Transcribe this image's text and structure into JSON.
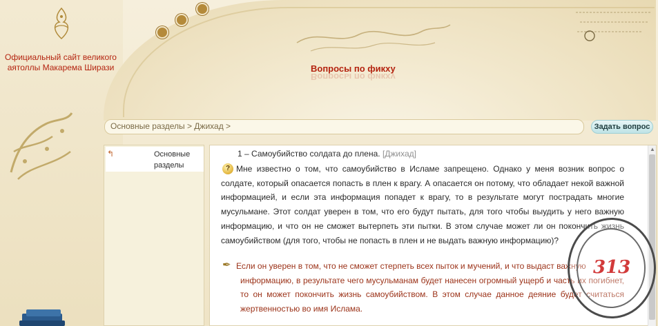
{
  "site": {
    "title": "Официальный сайт великого аятоллы Макарема Ширази"
  },
  "page": {
    "heading": "Вопросы по фикху"
  },
  "breadcrumb": {
    "path": "Основные разделы > Джихад >"
  },
  "actions": {
    "ask_label": "Задать вопрос"
  },
  "sidebar": {
    "items": [
      {
        "label": "Основные разделы"
      }
    ]
  },
  "question": {
    "title": "1 – Самоубийство солдата до плена.",
    "category": "[Джихад]",
    "text": "Мне известно о том, что самоубийство в Исламе запрещено. Однако у меня возник вопрос о солдате, который опасается попасть в плен к врагу. А опасается он потому, что обладает некой важной информацией, и если эта информация попадет к врагу, то в результате могут пострадать многие мусульмане. Этот солдат уверен в том, что его будут пытать, для того чтобы выудить у него важную информацию, и что он не сможет вытерпеть эти пытки. В этом случае может ли он покончить жизнь самоубийством (для того, чтобы не попасть в плен и не выдать важную информацию)?"
  },
  "answer": {
    "text_first": "Если он уверен в том, что не сможет стерпеть всех пыток и мучений, и что выдаст важную",
    "text_rest": "информацию, в результате чего мусульманам будет нанесен огромный ущерб и часть их погибнет, то он может покончить жизнь самоубийством. В этом случае данное деяние будет считаться жертвенностью во имя Ислама."
  },
  "watermark": {
    "number": "313"
  },
  "colors": {
    "accent_red": "#b4230f",
    "answer_text": "#9b3218",
    "ask_button_bg": "#bfe3e6"
  }
}
